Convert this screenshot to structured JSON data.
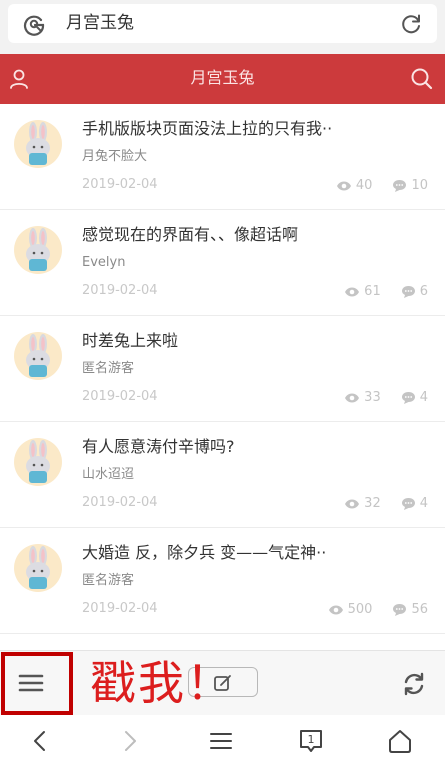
{
  "addressbar": {
    "query": "月宫玉兔",
    "left_icon": "search-g-icon",
    "right_icon": "reload-icon"
  },
  "header": {
    "title": "月宫玉兔",
    "left_icon": "user-icon",
    "right_icon": "search-icon",
    "color": "#cc3a3c"
  },
  "posts": [
    {
      "title": "手机版版块页面没法上拉的只有我··",
      "author": "月兔不脸大",
      "date": "2019-02-04",
      "views": "40",
      "comments": "10"
    },
    {
      "title": "感觉现在的界面有、、像超话啊",
      "author": "Evelyn",
      "date": "2019-02-04",
      "views": "61",
      "comments": "6"
    },
    {
      "title": "时差兔上来啦",
      "author": "匿名游客",
      "date": "2019-02-04",
      "views": "33",
      "comments": "4"
    },
    {
      "title": "有人愿意涛付辛博吗?",
      "author": "山水迢迢",
      "date": "2019-02-04",
      "views": "32",
      "comments": "4"
    },
    {
      "title": "大婚造 反，除夕兵 变——气定神··",
      "author": "匿名游客",
      "date": "2019-02-04",
      "views": "500",
      "comments": "56"
    }
  ],
  "toolbar": {
    "annotation": "戳我！",
    "menu_icon": "hamburger-menu-icon",
    "compose_icon": "compose-icon",
    "refresh_icon": "refresh-icon",
    "highlight_color": "#c00000"
  },
  "navbar": {
    "icons": [
      "back-icon",
      "forward-icon",
      "menu-icon",
      "tabs-icon",
      "home-icon"
    ],
    "tab_count": "1"
  }
}
